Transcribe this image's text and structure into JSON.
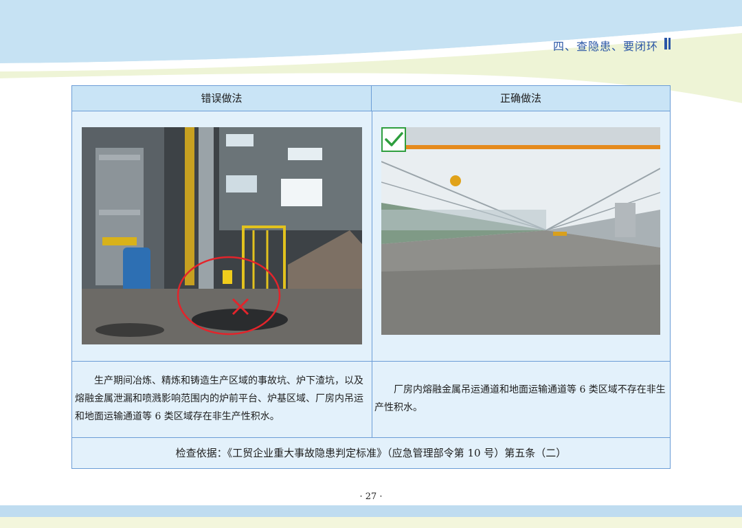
{
  "header": {
    "section_title": "四、查隐患、要闭环"
  },
  "table": {
    "col_wrong": "错误做法",
    "col_right": "正确做法",
    "wrong_desc": "生产期间冶炼、精炼和铸造生产区域的事故坑、炉下渣坑，以及熔融金属泄漏和喷溅影响范围内的炉前平台、炉基区域、厂房内吊运和地面运输通道等 6 类区域存在非生产性积水。",
    "right_desc": "厂房内熔融金属吊运通道和地面运输通道等 6 类区域不存在非生产性积水。",
    "basis": "检查依据：《工贸企业重大事故隐患判定标准》（应急管理部令第 10 号）第五条（二）"
  },
  "footer": {
    "page_number": "· 27 ·"
  },
  "colors": {
    "accent": "#2a56a6",
    "table_border": "#6a9cd6",
    "table_bg": "#e3f1fb",
    "header_bg": "#c9e4f6",
    "mark_wrong": "#e3242b",
    "mark_right": "#2e9e3e"
  },
  "icons": {
    "wrong_mark": "cross-icon",
    "right_mark": "checkmark-icon"
  }
}
